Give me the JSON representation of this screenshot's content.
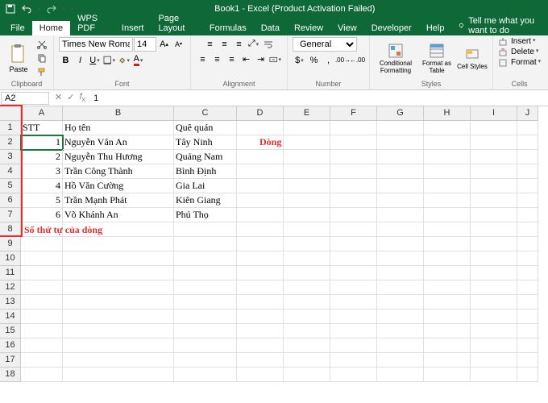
{
  "title": "Book1 - Excel (Product Activation Failed)",
  "tabs": [
    "File",
    "Home",
    "WPS PDF",
    "Insert",
    "Page Layout",
    "Formulas",
    "Data",
    "Review",
    "View",
    "Developer",
    "Help"
  ],
  "tell_me": "Tell me what you want to do",
  "groups": {
    "clipboard": "Clipboard",
    "font": "Font",
    "alignment": "Alignment",
    "number": "Number",
    "styles": "Styles",
    "cells": "Cells"
  },
  "clipboard": {
    "paste": "Paste"
  },
  "font": {
    "name": "Times New Roman",
    "size": "14"
  },
  "number": {
    "format": "General"
  },
  "styles": {
    "cond": "Conditional Formatting",
    "table": "Format as Table",
    "cell": "Cell Styles"
  },
  "cells": {
    "insert": "Insert",
    "delete": "Delete",
    "format": "Format"
  },
  "name_box": "A2",
  "formula": "1",
  "columns": [
    "A",
    "B",
    "C",
    "D",
    "E",
    "F",
    "G",
    "H",
    "I",
    "J"
  ],
  "rows": [
    "1",
    "2",
    "3",
    "4",
    "5",
    "6",
    "7",
    "8",
    "9",
    "10",
    "11",
    "12",
    "13",
    "14",
    "15",
    "16",
    "17",
    "18"
  ],
  "data_rows": [
    {
      "a": "STT",
      "b": "Họ tên",
      "c": "Quê quán"
    },
    {
      "a": "1",
      "b": "Nguyễn Văn An",
      "c": "Tây Ninh"
    },
    {
      "a": "2",
      "b": "Nguyễn Thu Hương",
      "c": "Quảng Nam"
    },
    {
      "a": "3",
      "b": "Trần Công Thành",
      "c": "Bình Định"
    },
    {
      "a": "4",
      "b": "Hồ Văn Cường",
      "c": "Gia Lai"
    },
    {
      "a": "5",
      "b": "Trần Mạnh Phát",
      "c": "Kiên Giang"
    },
    {
      "a": "6",
      "b": "Võ Khánh An",
      "c": "Phú Thọ"
    }
  ],
  "annotations": {
    "rows_label": "Số thứ tự của dòng",
    "row_word": "Dòng"
  }
}
